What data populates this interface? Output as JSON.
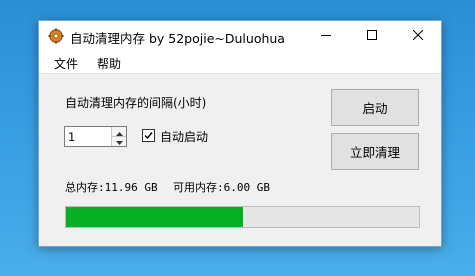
{
  "window": {
    "title": "自动清理内存 by 52pojie~Duluohua",
    "controls": {
      "minimize": "minimize-icon",
      "maximize": "maximize-icon",
      "close": "close-icon"
    }
  },
  "menu": [
    "文件",
    "帮助"
  ],
  "settings": {
    "interval_label": "自动清理内存的间隔(小时)",
    "interval_value": "1",
    "autostart_label": "自动启动",
    "autostart_checked": true
  },
  "memory": {
    "total_label": "总内存:11.96 GB",
    "available_label": "可用内存:6.00 GB"
  },
  "buttons": {
    "start": "启动",
    "clean_now": "立即清理"
  },
  "progress": {
    "fraction": 0.5,
    "fill_color": "#06b025"
  }
}
